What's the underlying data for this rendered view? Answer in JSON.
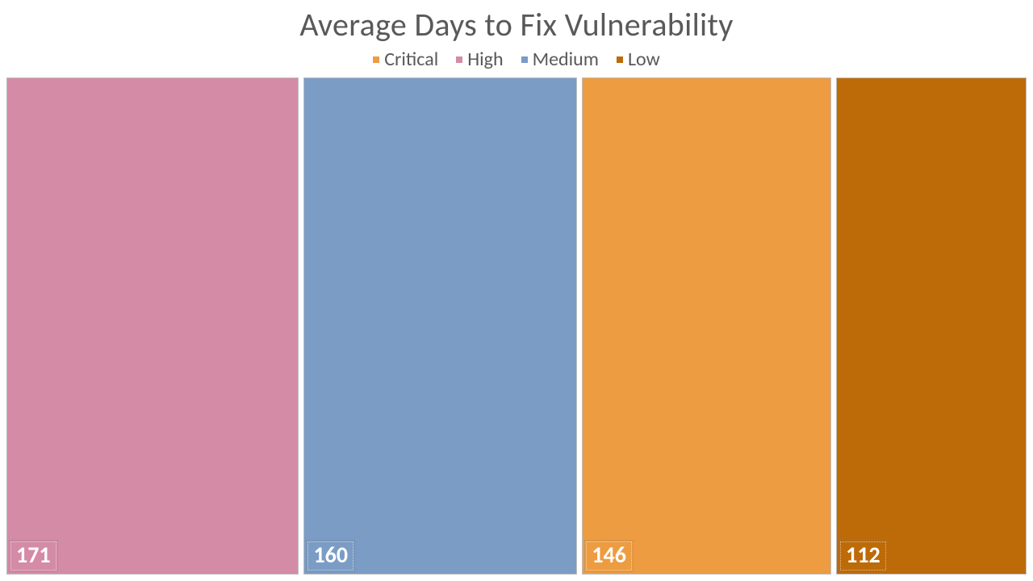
{
  "chart_data": {
    "type": "bar",
    "title": "Average Days to Fix Vulnerability",
    "categories": [
      "High",
      "Medium",
      "Critical",
      "Low"
    ],
    "values": [
      171,
      160,
      146,
      112
    ],
    "legend_order": [
      "Critical",
      "High",
      "Medium",
      "Low"
    ],
    "colors": {
      "Critical": "#ed9c41",
      "High": "#d48ba6",
      "Medium": "#7b9cc5",
      "Low": "#bd6b09"
    },
    "layout": "treemap-row",
    "xlabel": "",
    "ylabel": ""
  }
}
